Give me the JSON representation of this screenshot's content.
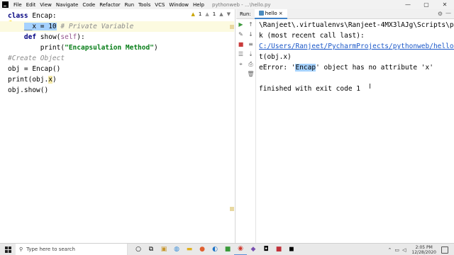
{
  "window": {
    "menus": [
      "File",
      "Edit",
      "View",
      "Navigate",
      "Code",
      "Refactor",
      "Run",
      "Tools",
      "VCS",
      "Window",
      "Help"
    ],
    "title": "pythonweb - ...\\hello.py",
    "controls": [
      "—",
      "▢",
      "✕"
    ]
  },
  "editor": {
    "inspection": {
      "warnings": "1",
      "weak": "1",
      "up": "▲",
      "down": "▼"
    },
    "lines": {
      "l1": {
        "kw": "class",
        "rest": " Encap:"
      },
      "l2": {
        "selected": "__x = 10",
        "comment": " # Private Variable"
      },
      "l3": {
        "kw": "def",
        "name": " show(",
        "self": "self",
        "end": "):"
      },
      "l4": {
        "fn": "print(",
        "str": "\"Encapsulation Method\"",
        "end": ")"
      },
      "l5": {
        "comment": "#Create Object"
      },
      "l6": {
        "text": "obj = Encap()"
      },
      "l7": {
        "pre": "print(obj.",
        "attr": "x",
        "end": ")"
      },
      "l8": {
        "text": "obj.show()"
      }
    }
  },
  "run": {
    "label": "Run:",
    "tab": "hello",
    "close": "×",
    "settings": "⚙",
    "minimize": "—",
    "console": {
      "c1": "\\Ranjeet\\.virtualenvs\\Ranjeet-4MX3lAJg\\Scripts\\py",
      "c2": "k (most recent call last):",
      "c3_link": "C:/Users/Ranjeet/PycharmProjects/pythonweb/hello.",
      "c4": "t(obj.x)",
      "c5_pre": "eError: '",
      "c5_hl": "Encap",
      "c5_post": "' object has no attribute 'x'",
      "c6": "",
      "c7": "finished with exit code 1"
    }
  },
  "taskbar": {
    "search_placeholder": "Type here to search",
    "time": "2:05 PM",
    "date": "12/28/2020"
  },
  "colors": {
    "selection": "#a6d2ff",
    "link": "#1a57c8",
    "keyword": "#000080",
    "string": "#067d17",
    "comment": "#8c8c8c"
  }
}
